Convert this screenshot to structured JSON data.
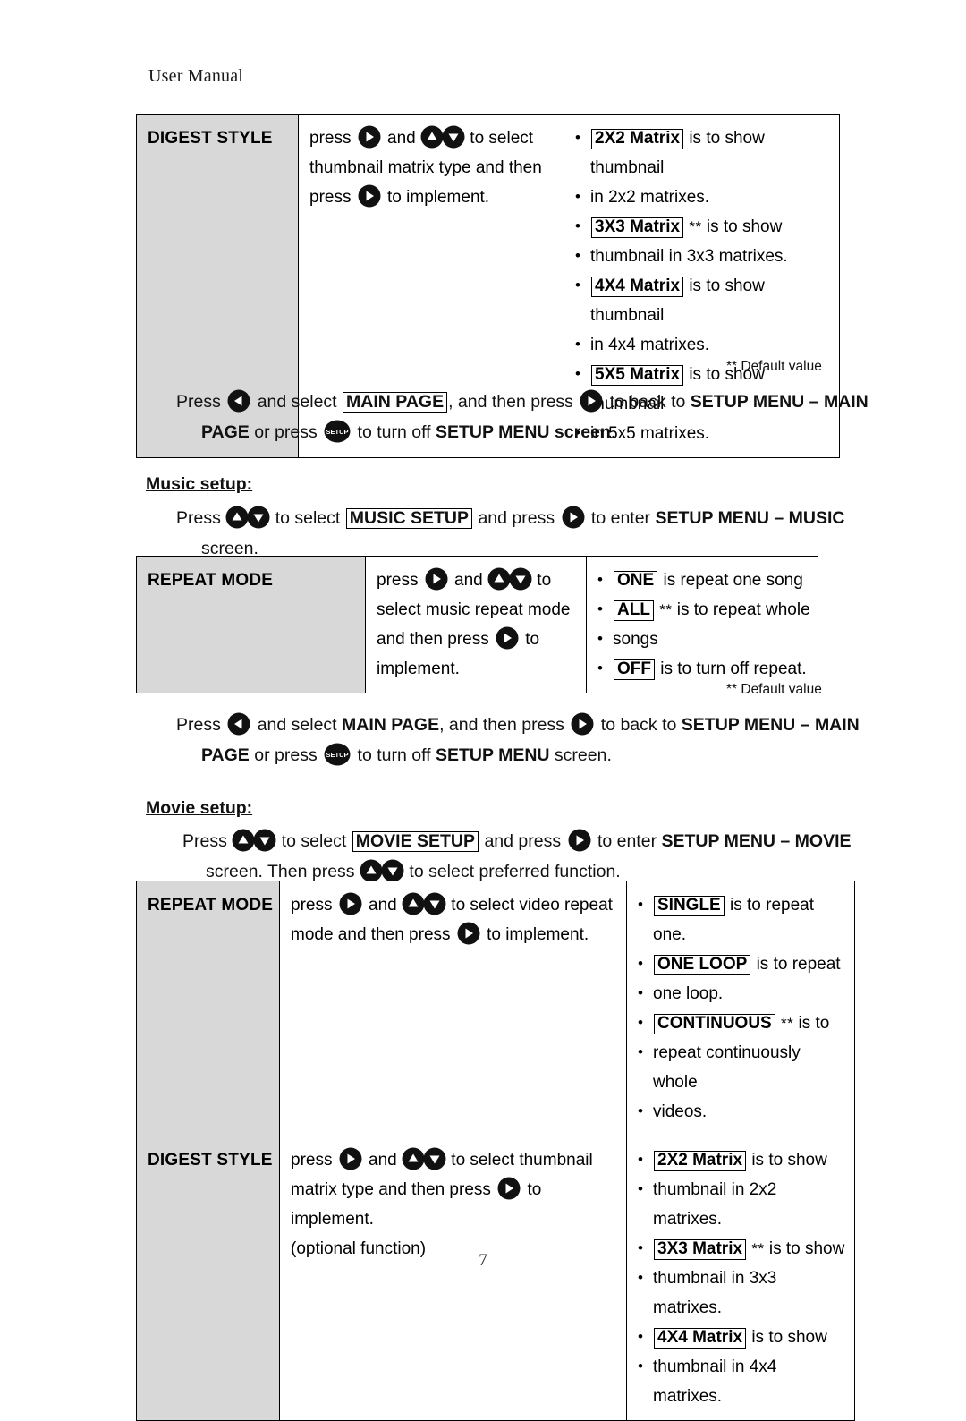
{
  "document": {
    "header": "User Manual",
    "page_number": "7",
    "default_note": "** Default value"
  },
  "icons": {
    "right": "play-right-arrow-key-icon",
    "left": "left-arrow-key-icon",
    "up": "up-arrow-key-icon",
    "down": "down-arrow-key-icon",
    "setup": "setup-key-icon",
    "setup_label": "SETUP"
  },
  "digest_table": {
    "name": "DIGEST STYLE",
    "description": {
      "l1_a": "press",
      "l1_b": "and",
      "l1_c": "to select",
      "l2": "thumbnail matrix type and then",
      "l3_a": "press",
      "l3_b": "to implement."
    },
    "options": [
      {
        "label": "2X2 Matrix",
        "default": false,
        "text": "is to show thumbnail",
        "cont": "in 2x2 matrixes."
      },
      {
        "label": "3X3 Matrix",
        "default": true,
        "text": "is to show",
        "cont": "thumbnail in 3x3 matrixes."
      },
      {
        "label": "4X4 Matrix",
        "default": false,
        "text": "is to show thumbnail",
        "cont": "in 4x4 matrixes."
      },
      {
        "label": "5X5 Matrix",
        "default": false,
        "text": "is to show thumbnail",
        "cont": "in 5x5 matrixes."
      }
    ]
  },
  "para_back_1": {
    "l1_a": "Press",
    "l1_b": "and select",
    "l1_boxed": "MAIN PAGE",
    "l1_c": ", and then press",
    "l1_d": "to back to",
    "l1_e": "SETUP MENU – MAIN",
    "l2_a": "PAGE",
    "l2_b": "or press",
    "l2_c": "to turn off",
    "l2_d": "SETUP MENU screen",
    "l2_e": "."
  },
  "music_section": {
    "heading": "Music setup:",
    "intro": {
      "l1_a": "Press",
      "l1_b": "to select",
      "l1_boxed": "MUSIC SETUP",
      "l1_c": "and press",
      "l1_d": "to enter",
      "l1_e": "SETUP MENU – MUSIC",
      "l2": "screen."
    },
    "table": {
      "name": "REPEAT MODE",
      "description": {
        "l1_a": "press",
        "l1_b": "and",
        "l1_c": "to",
        "l2": "select music repeat mode",
        "l3_a": "and then press",
        "l3_b": "to",
        "l4": "implement."
      },
      "options": [
        {
          "label": "ONE",
          "default": false,
          "text": "is repeat one song",
          "cont": ""
        },
        {
          "label": "ALL",
          "default": true,
          "text": "is to repeat whole",
          "cont": "songs"
        },
        {
          "label": "OFF",
          "default": false,
          "text": "is to turn off repeat.",
          "cont": ""
        }
      ]
    }
  },
  "para_back_2": {
    "l1_a": "Press",
    "l1_b": "and select",
    "l1_bold": "MAIN PAGE",
    "l1_c": ", and then press",
    "l1_d": "to back to",
    "l1_e": "SETUP MENU – MAIN",
    "l2_a": "PAGE",
    "l2_b": "or press",
    "l2_c": "to turn off",
    "l2_d": "SETUP MENU",
    "l2_e": "screen."
  },
  "movie_section": {
    "heading": "Movie setup:",
    "intro": {
      "l1_a": "Press",
      "l1_b": "to select",
      "l1_boxed": "MOVIE SETUP",
      "l1_c": "and press",
      "l1_d": "to enter",
      "l1_e": "SETUP MENU – MOVIE",
      "l2_a": "screen. Then press",
      "l2_b": "to select preferred function."
    },
    "repeat_row": {
      "name": "REPEAT MODE",
      "description": {
        "l1_a": "press",
        "l1_b": "and",
        "l1_c": "to select video repeat",
        "l2_a": "mode and then press",
        "l2_b": "to implement."
      },
      "options": [
        {
          "label": "SINGLE",
          "default": false,
          "text": "is to repeat one.",
          "cont": ""
        },
        {
          "label": "ONE LOOP",
          "default": false,
          "text": "is to repeat",
          "cont": "one loop."
        },
        {
          "label": "CONTINUOUS",
          "default": true,
          "text": "is to",
          "cont": "repeat continuously whole",
          "cont2": "videos."
        }
      ]
    },
    "digest_row": {
      "name": "DIGEST STYLE",
      "description": {
        "l1_a": "press",
        "l1_b": "and",
        "l1_c": "to select thumbnail",
        "l2_a": "matrix type and then press",
        "l2_b": "to implement.",
        "l3": "(optional function)"
      },
      "options": [
        {
          "label": "2X2 Matrix",
          "default": false,
          "text": "is to show",
          "cont": "thumbnail in 2x2 matrixes."
        },
        {
          "label": "3X3 Matrix",
          "default": true,
          "text": "is to show",
          "cont": "thumbnail in 3x3 matrixes."
        },
        {
          "label": "4X4 Matrix",
          "default": false,
          "text": "is to show",
          "cont": "thumbnail in 4x4 matrixes."
        }
      ]
    }
  }
}
